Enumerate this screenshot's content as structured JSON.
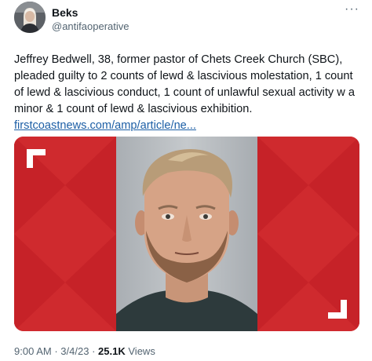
{
  "tweet": {
    "author_name": "Beks",
    "author_handle": "@antifaoperative",
    "more_icon": "···",
    "text": "Jeffrey Bedwell, 38, former pastor of Chets Creek Church (SBC), pleaded guilty to 2 counts of lewd & lascivious molestation, 1 count of lewd & lascivious conduct, 1 count of unlawful sexual activity w a minor & 1 count of lewd & lascivious exhibition.",
    "link_text": "firstcoastnews.com/amp/article/ne...",
    "time": "9:00 AM",
    "separator": "·",
    "date": "3/4/23",
    "views_count": "25.1K",
    "views_label": "Views"
  },
  "colors": {
    "media_red": "#cf2a2e",
    "media_red_dark": "#b51f26",
    "link": "#1d5fa6",
    "secondary_text": "#536471"
  }
}
